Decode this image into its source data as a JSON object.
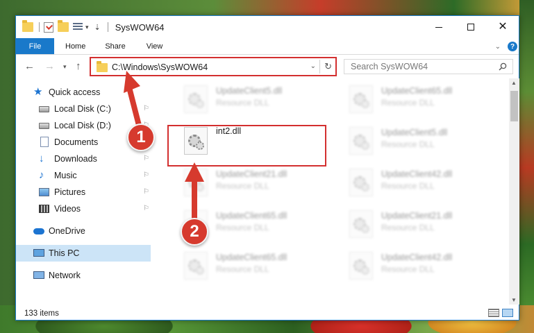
{
  "window": {
    "title": "SysWOW64"
  },
  "ribbon": {
    "tabs": [
      {
        "label": "File"
      },
      {
        "label": "Home"
      },
      {
        "label": "Share"
      },
      {
        "label": "View"
      }
    ],
    "help_icon": "?"
  },
  "address": {
    "path": "C:\\Windows\\SysWOW64",
    "search_placeholder": "Search SysWOW64"
  },
  "nav": {
    "items": [
      {
        "label": "Quick access",
        "icon": "star-icon"
      },
      {
        "label": "Local Disk (C:)",
        "icon": "disk-icon"
      },
      {
        "label": "Local Disk (D:)",
        "icon": "disk-icon"
      },
      {
        "label": "Documents",
        "icon": "document-icon"
      },
      {
        "label": "Downloads",
        "icon": "download-icon"
      },
      {
        "label": "Music",
        "icon": "music-icon"
      },
      {
        "label": "Pictures",
        "icon": "pictures-icon"
      },
      {
        "label": "Videos",
        "icon": "videos-icon"
      },
      {
        "label": "OneDrive",
        "icon": "cloud-icon"
      },
      {
        "label": "This PC",
        "icon": "computer-icon"
      },
      {
        "label": "Network",
        "icon": "network-icon"
      }
    ]
  },
  "files": [
    {
      "name": "UpdateClient5.dll",
      "type": "Resource DLL"
    },
    {
      "name": "UpdateClient65.dll",
      "type": "Resource DLL"
    },
    {
      "name": "int2.dll",
      "type": ""
    },
    {
      "name": "UpdateClient5.dll",
      "type": "Resource DLL"
    },
    {
      "name": "UpdateClient21.dll",
      "type": "Resource DLL"
    },
    {
      "name": "UpdateClient42.dll",
      "type": "Resource DLL"
    },
    {
      "name": "UpdateClient65.dll",
      "type": "Resource DLL"
    },
    {
      "name": "UpdateClient21.dll",
      "type": "Resource DLL"
    },
    {
      "name": "UpdateClient65.dll",
      "type": "Resource DLL"
    },
    {
      "name": "UpdateClient42.dll",
      "type": "Resource DLL"
    }
  ],
  "status": {
    "item_count": "133 items"
  },
  "annotations": {
    "step1": "1",
    "step2": "2"
  },
  "colors": {
    "accent": "#1979ca",
    "highlight": "#d32f2f",
    "badge": "#d63a2e",
    "selected": "#cce4f7"
  }
}
